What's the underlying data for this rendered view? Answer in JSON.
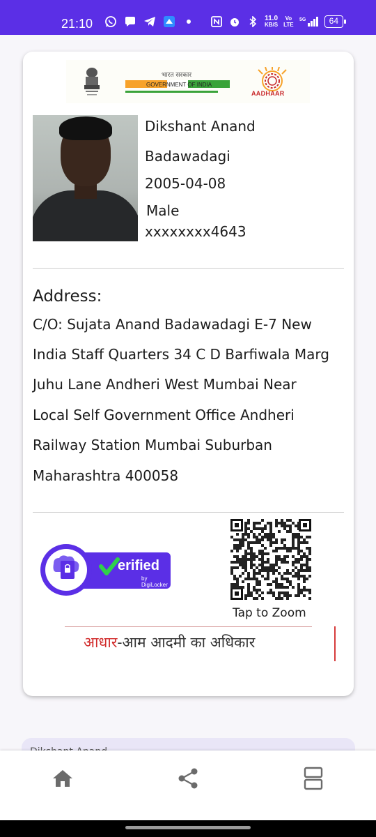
{
  "status_bar": {
    "time": "21:10",
    "net_speed_value": "11.0",
    "net_speed_unit": "KB/S",
    "network_type": "5G",
    "battery": "64",
    "colors": {
      "bar": "#5b2fe6"
    }
  },
  "card": {
    "header": {
      "gov_hindi": "भारत सरकार",
      "gov_english": "GOVERNMENT OF INDIA",
      "aadhaar_label": "AADHAAR"
    },
    "holder": {
      "name": "Dikshant Anand",
      "surname": "Badawadagi",
      "dob": "2005-04-08",
      "gender": "Male",
      "masked_number": "xxxxxxxx4643"
    },
    "address": {
      "title": "Address:",
      "lines": [
        "C/O: Sujata Anand Badawadagi E-7 New",
        "India Staff Quarters 34 C D Barfiwala Marg",
        "Juhu Lane Andheri West Mumbai Near",
        "Local Self Government Office Andheri",
        "Railway Station Mumbai Suburban",
        "Maharashtra 400058"
      ]
    },
    "verified_badge": {
      "text": "erified",
      "sub": "by DigiLocker"
    },
    "qr_caption": "Tap to Zoom",
    "slogan": {
      "red_part": "आधार",
      "rest": "-आम आदमी का अधिकार"
    }
  },
  "peek_card_text": "Dikshant Anand",
  "bottom_nav": {
    "items": [
      {
        "icon": "home-icon"
      },
      {
        "icon": "share-icon"
      },
      {
        "icon": "view-agenda-icon"
      }
    ]
  }
}
